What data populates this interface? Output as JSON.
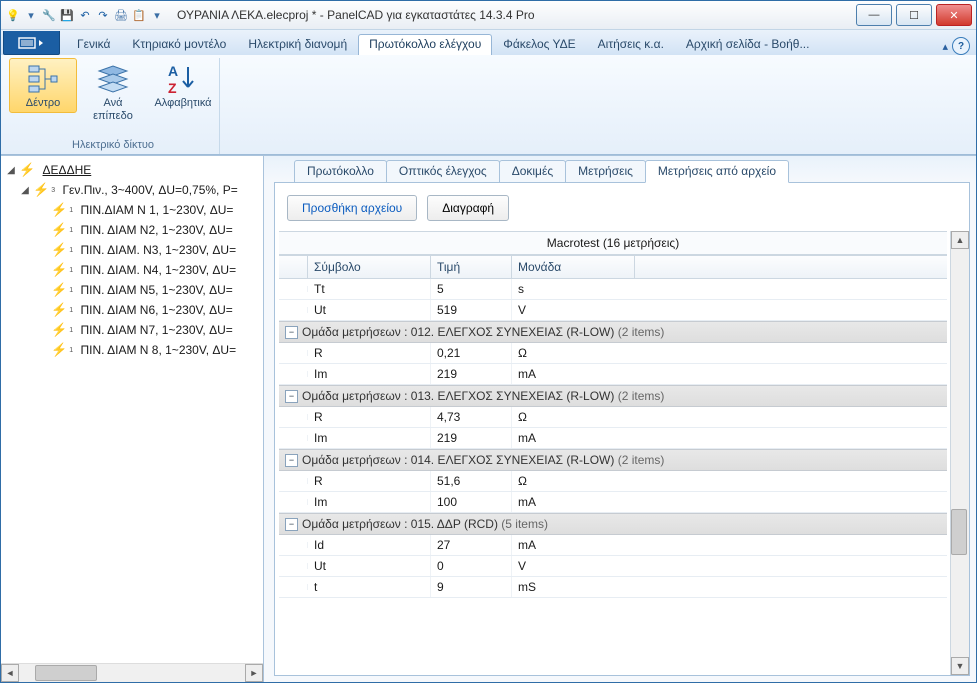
{
  "window": {
    "title": "ΟΥΡΑΝΙΑ ΛΕΚΑ.elecproj * - PanelCAD για εγκαταστάτες 14.3.4 Pro"
  },
  "qat": {
    "icons": [
      "bulb",
      "dash",
      "wrench",
      "save",
      "undo",
      "redo",
      "print",
      "paste",
      "dash2"
    ]
  },
  "ribbon_tabs": {
    "items": [
      "Γενικά",
      "Κτηριακό μοντέλο",
      "Ηλεκτρική διανομή",
      "Πρωτόκολλο ελέγχου",
      "Φάκελος ΥΔΕ",
      "Αιτήσεις κ.α.",
      "Αρχική σελίδα - Βοήθ..."
    ],
    "active_index": 3
  },
  "ribbon": {
    "group_title": "Ηλεκτρικό δίκτυο",
    "btn1": "Δέντρο",
    "btn2_l1": "Ανά",
    "btn2_l2": "επίπεδο",
    "btn3": "Αλφαβητικά"
  },
  "tree": {
    "root": "ΔΕΔΔΗΕ",
    "main": "Γεν.Πιν., 3~400V, ΔU=0,75%, P=",
    "children": [
      "ΠΙΝ.ΔΙΑΜ Ν 1, 1~230V, ΔU=",
      "ΠΙΝ. ΔΙΑΜ Ν2, 1~230V, ΔU=",
      "ΠΙΝ. ΔΙΑΜ. Ν3, 1~230V, ΔU=",
      "ΠΙΝ. ΔΙΑΜ. Ν4, 1~230V, ΔU=",
      "ΠΙΝ. ΔΙΑΜ Ν5, 1~230V, ΔU=",
      "ΠΙΝ. ΔΙΑΜ Ν6, 1~230V, ΔU=",
      "ΠΙΝ. ΔΙΑΜ Ν7, 1~230V, ΔU=",
      "ΠΙΝ. ΔΙΑΜ Ν 8, 1~230V, ΔU="
    ]
  },
  "inner_tabs": {
    "items": [
      "Πρωτόκολλο",
      "Οπτικός έλεγχος",
      "Δοκιμές",
      "Μετρήσεις",
      "Μετρήσεις από αρχείο"
    ],
    "active_index": 4
  },
  "toolbar": {
    "add": "Προσθήκη αρχείου",
    "del": "Διαγραφή"
  },
  "grid": {
    "title": "Macrotest (16 μετρήσεις)",
    "head_symbol": "Σύμβολο",
    "head_value": "Τιμή",
    "head_unit": "Μονάδα",
    "pre_rows": [
      {
        "sym": "Tt",
        "val": "5",
        "unit": "s"
      },
      {
        "sym": "Ut",
        "val": "519",
        "unit": "V"
      }
    ],
    "groups": [
      {
        "label": "Ομάδα μετρήσεων : 012. ΕΛΕΓΧΟΣ ΣΥΝΕΧΕΙΑΣ (R-LOW)",
        "count": "(2 items)",
        "rows": [
          {
            "sym": "R",
            "val": "0,21",
            "unit": "Ω"
          },
          {
            "sym": "Im",
            "val": "219",
            "unit": "mA"
          }
        ]
      },
      {
        "label": "Ομάδα μετρήσεων : 013. ΕΛΕΓΧΟΣ ΣΥΝΕΧΕΙΑΣ (R-LOW)",
        "count": "(2 items)",
        "rows": [
          {
            "sym": "R",
            "val": "4,73",
            "unit": "Ω"
          },
          {
            "sym": "Im",
            "val": "219",
            "unit": "mA"
          }
        ]
      },
      {
        "label": "Ομάδα μετρήσεων : 014. ΕΛΕΓΧΟΣ ΣΥΝΕΧΕΙΑΣ (R-LOW)",
        "count": "(2 items)",
        "rows": [
          {
            "sym": "R",
            "val": "51,6",
            "unit": "Ω"
          },
          {
            "sym": "Im",
            "val": "100",
            "unit": "mA"
          }
        ]
      },
      {
        "label": "Ομάδα μετρήσεων : 015. ΔΔΡ (RCD)",
        "count": "(5 items)",
        "rows": [
          {
            "sym": "Id",
            "val": "27",
            "unit": "mA"
          },
          {
            "sym": "Ut",
            "val": "0",
            "unit": "V"
          },
          {
            "sym": "t",
            "val": "9",
            "unit": "mS"
          }
        ]
      }
    ]
  }
}
